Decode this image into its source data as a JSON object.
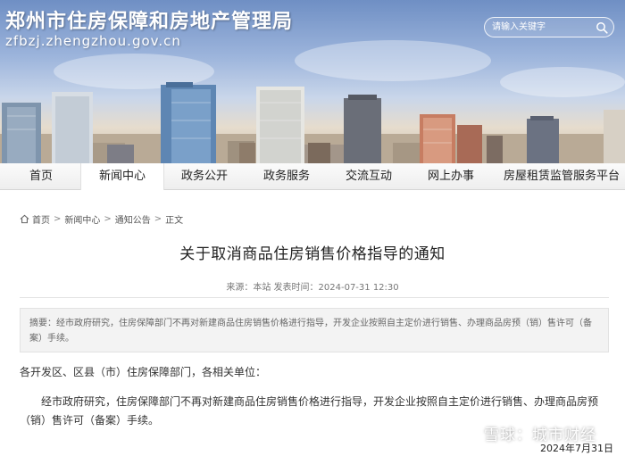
{
  "header": {
    "site_title": "郑州市住房保障和房地产管理局",
    "site_domain": "zfbzj.zhengzhou.gov.cn",
    "search_placeholder": "请输入关键字"
  },
  "nav": {
    "items": [
      {
        "label": "首页"
      },
      {
        "label": "新闻中心"
      },
      {
        "label": "政务公开"
      },
      {
        "label": "政务服务"
      },
      {
        "label": "交流互动"
      },
      {
        "label": "网上办事"
      },
      {
        "label": "房屋租赁监管服务平台"
      }
    ],
    "active_index": 1
  },
  "breadcrumb": {
    "items": [
      "首页",
      "新闻中心",
      "通知公告",
      "正文"
    ],
    "separator": ">"
  },
  "article": {
    "title": "关于取消商品住房销售价格指导的通知",
    "meta": "来源：本站  发表时间：2024-07-31 12:30",
    "summary": "摘要：经市政府研究，住房保障部门不再对新建商品住房销售价格进行指导，开发企业按照自主定价进行销售、办理商品房预（销）售许可（备案）手续。",
    "salutation": "各开发区、区县（市）住房保障部门，各相关单位：",
    "paragraph": "经市政府研究，住房保障部门不再对新建商品住房销售价格进行指导，开发企业按照自主定价进行销售、办理商品房预（销）售许可（备案）手续。"
  },
  "overlay": {
    "watermark": "雪球：城市财经",
    "date": "2024年7月31日"
  },
  "colors": {
    "sky_top": "#6f8fc4",
    "nav_bg": "#eeeeee",
    "summary_bg": "#f3f3f3"
  },
  "icons": [
    "search-icon",
    "home-icon",
    "snowball-icon"
  ]
}
